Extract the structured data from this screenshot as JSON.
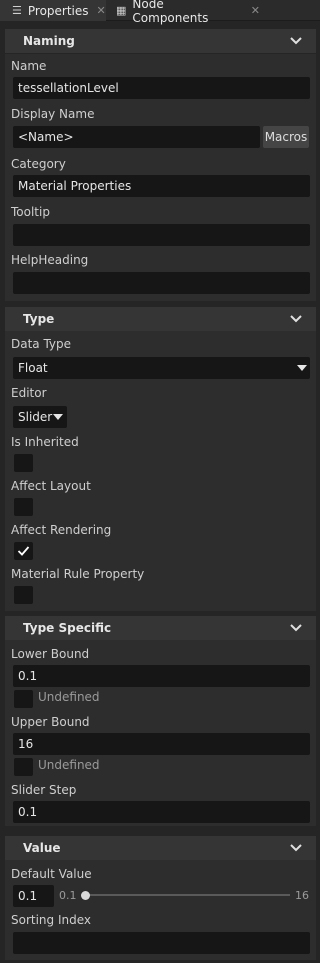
{
  "tabs": [
    {
      "label": "Properties",
      "icon": "list-icon"
    },
    {
      "label": "Node Components",
      "icon": "components-icon"
    }
  ],
  "sections": {
    "naming": "Naming",
    "type": "Type",
    "type_specific": "Type Specific",
    "value": "Value"
  },
  "naming": {
    "name_label": "Name",
    "name_value": "tessellationLevel",
    "display_name_label": "Display Name",
    "display_name_value": "<Name>",
    "macros_button": "Macros",
    "category_label": "Category",
    "category_value": "Material Properties",
    "tooltip_label": "Tooltip",
    "tooltip_value": "",
    "help_heading_label": "HelpHeading",
    "help_heading_value": ""
  },
  "type": {
    "data_type_label": "Data Type",
    "data_type_value": "Float",
    "editor_label": "Editor",
    "editor_value": "Slider",
    "is_inherited_label": "Is Inherited",
    "is_inherited": false,
    "affect_layout_label": "Affect Layout",
    "affect_layout": false,
    "affect_rendering_label": "Affect Rendering",
    "affect_rendering": true,
    "material_rule_label": "Material Rule Property",
    "material_rule": false
  },
  "type_specific": {
    "lower_bound_label": "Lower Bound",
    "lower_bound_value": "0.1",
    "lower_undefined_label": "Undefined",
    "upper_bound_label": "Upper Bound",
    "upper_bound_value": "16",
    "upper_undefined_label": "Undefined",
    "slider_step_label": "Slider Step",
    "slider_step_value": "0.1"
  },
  "value": {
    "default_value_label": "Default Value",
    "default_value": "0.1",
    "slider_min": "0.1",
    "slider_max": "16",
    "slider_position": 0.0,
    "sorting_index_label": "Sorting Index",
    "sorting_index_value": ""
  }
}
